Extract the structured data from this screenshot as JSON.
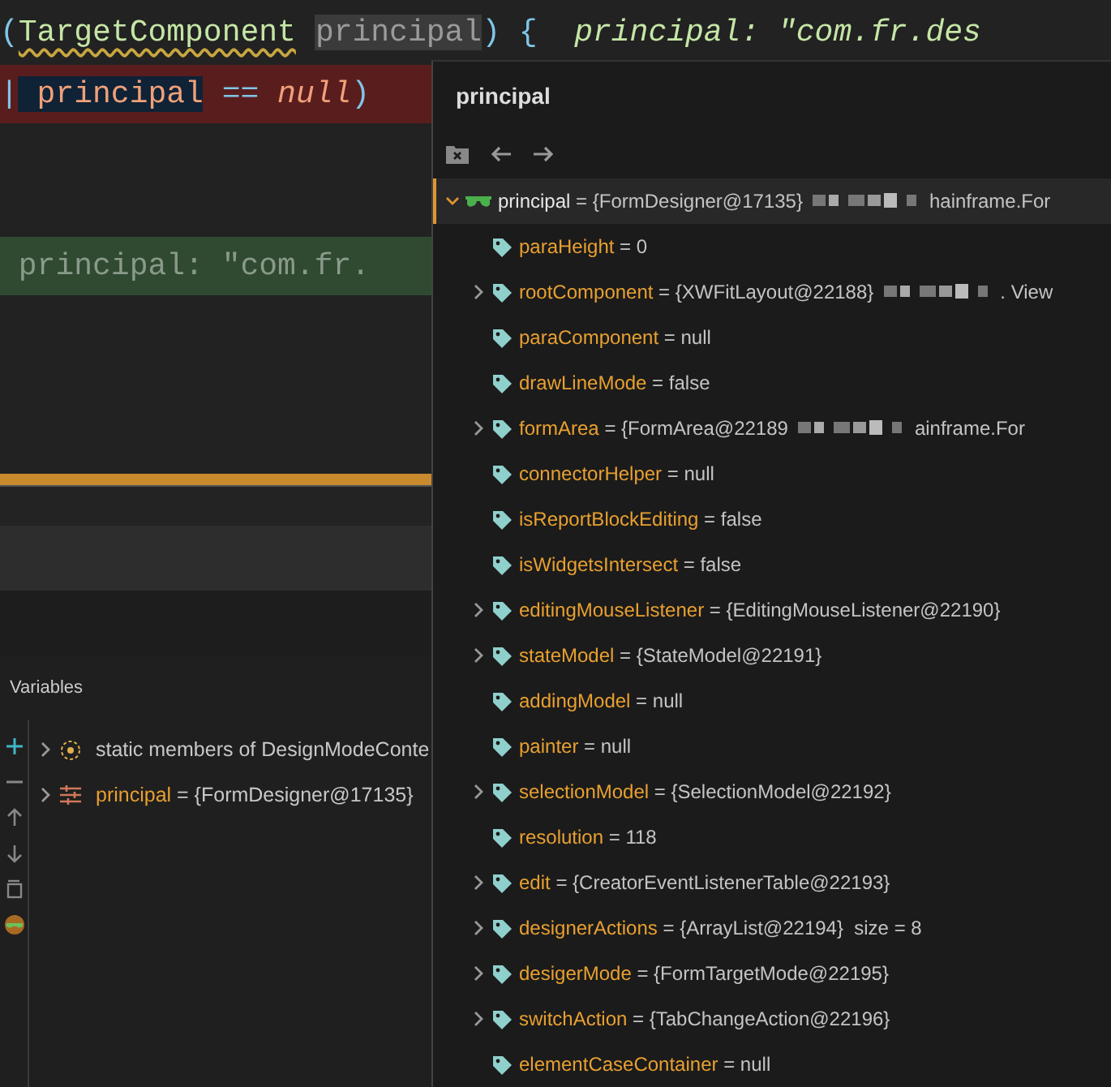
{
  "editor": {
    "lines": [
      {
        "kind": "code",
        "segments": [
          {
            "kind": "punct",
            "text": "("
          },
          {
            "kind": "warning",
            "text": "TargetComponent"
          },
          {
            "kind": "usage",
            "text": "principal"
          },
          {
            "kind": "punct",
            "text": ") {"
          },
          {
            "kind": "hint",
            "text": "  principal: \"com.fr.des"
          }
        ]
      },
      {
        "kind": "error",
        "segments": [
          {
            "kind": "punct",
            "text": "|"
          },
          {
            "kind": "caret",
            "text": " principal"
          },
          {
            "kind": "operator",
            "text": " =="
          },
          {
            "kind": "keyword",
            "text": " null"
          },
          {
            "kind": "punct",
            "text": ")"
          }
        ]
      },
      {
        "kind": "current",
        "segments": [
          {
            "kind": "faded",
            "text": " principal: \"com.fr."
          }
        ]
      }
    ]
  },
  "variables": {
    "title": "Variables",
    "toolbar": [
      {
        "kind": "add"
      },
      {
        "kind": "remove"
      },
      {
        "kind": "up"
      },
      {
        "kind": "down"
      },
      {
        "kind": "copy"
      },
      {
        "kind": "watch"
      }
    ],
    "items": [
      {
        "kind": "static",
        "name": "static members of DesignModeConte",
        "expanded": false,
        "selected": false
      },
      {
        "kind": "field",
        "name": "principal",
        "value": " = {FormDesigner@17135}",
        "expanded": false,
        "selected": false
      }
    ]
  },
  "popup": {
    "title": "principal",
    "root": {
      "name": "principal",
      "value": " = {FormDesigner@17135}",
      "redacted": true,
      "tail": "hainframe.For",
      "expanded": true,
      "selected": true,
      "children": [
        {
          "name": "paraHeight",
          "value": " = 0",
          "kind": "leaf"
        },
        {
          "name": "rootComponent",
          "value": " = {XWFitLayout@22188}",
          "redacted": true,
          "tail": ". View",
          "kind": "node",
          "expanded": false
        },
        {
          "name": "paraComponent",
          "value": " = null",
          "kind": "leaf"
        },
        {
          "name": "drawLineMode",
          "value": " = false",
          "kind": "leaf"
        },
        {
          "name": "formArea",
          "value": " = {FormArea@22189",
          "redacted": true,
          "tail": "ainframe.For",
          "kind": "node",
          "expanded": false
        },
        {
          "name": "connectorHelper",
          "value": " = null",
          "kind": "leaf"
        },
        {
          "name": "isReportBlockEditing",
          "value": " = false",
          "kind": "leaf"
        },
        {
          "name": "isWidgetsIntersect",
          "value": " = false",
          "kind": "leaf"
        },
        {
          "name": "editingMouseListener",
          "value": " = {EditingMouseListener@22190}",
          "kind": "node",
          "expanded": false
        },
        {
          "name": "stateModel",
          "value": " = {StateModel@22191}",
          "kind": "node",
          "expanded": false
        },
        {
          "name": "addingModel",
          "value": " = null",
          "kind": "leaf"
        },
        {
          "name": "painter",
          "value": " = null",
          "kind": "leaf"
        },
        {
          "name": "selectionModel",
          "value": " = {SelectionModel@22192}",
          "kind": "node",
          "expanded": false
        },
        {
          "name": "resolution",
          "value": " = 118",
          "kind": "leaf"
        },
        {
          "name": "edit",
          "value": " = {CreatorEventListenerTable@22193}",
          "kind": "node",
          "expanded": false
        },
        {
          "name": "designerActions",
          "value": " = {ArrayList@22194}  size = 8",
          "kind": "node",
          "expanded": false
        },
        {
          "name": "desigerMode",
          "value": " = {FormTargetMode@22195}",
          "kind": "node",
          "expanded": false
        },
        {
          "name": "switchAction",
          "value": " = {TabChangeAction@22196}",
          "kind": "node",
          "expanded": false
        },
        {
          "name": "elementCaseContainer",
          "value": " = null",
          "kind": "leaf"
        }
      ]
    }
  }
}
